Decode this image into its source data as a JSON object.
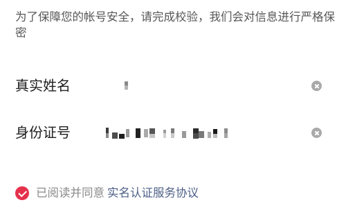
{
  "notice": "为了保障您的帐号安全，请完成校验，我们会对信息进行严格保密",
  "form": {
    "name": {
      "label": "真实姓名",
      "value": "",
      "clear_icon": "clear-icon"
    },
    "id_number": {
      "label": "身份证号",
      "value": "",
      "clear_icon": "clear-icon"
    }
  },
  "agreement": {
    "checked": true,
    "checkbox_icon": "check-icon",
    "text": "已阅读并同意",
    "link": "实名认证服务协议"
  },
  "colors": {
    "accent": "#e5314c",
    "link": "#4d5f86",
    "clear_icon": "#a9a9a9"
  }
}
